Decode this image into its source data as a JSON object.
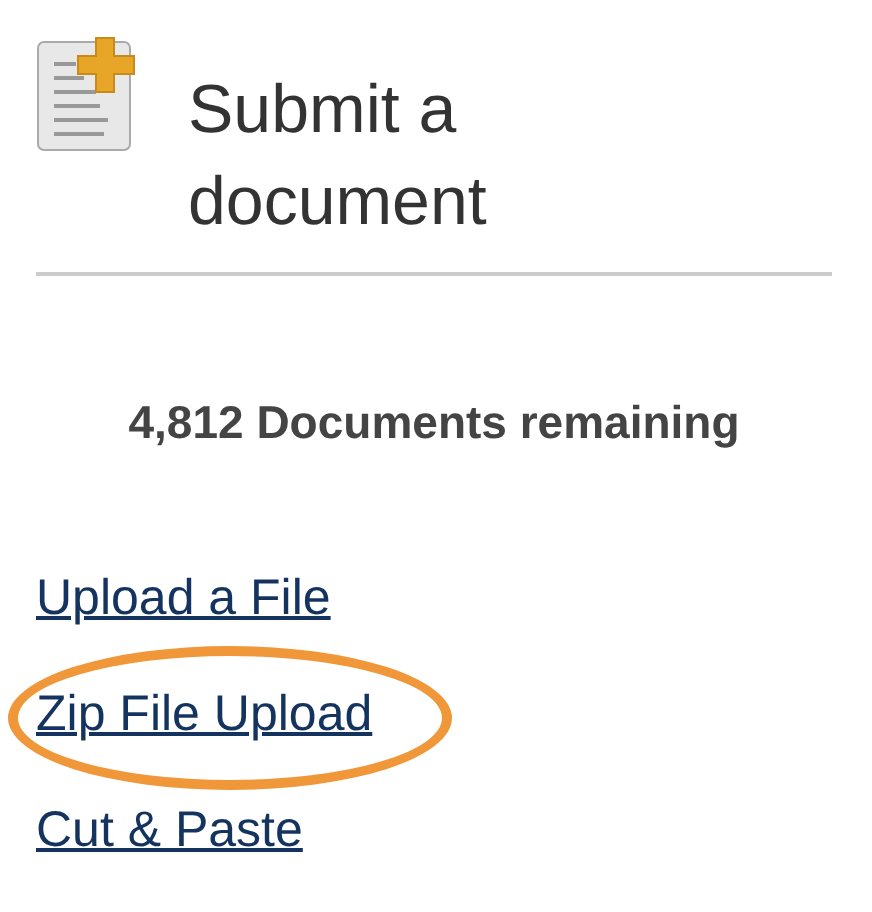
{
  "title": "Submit a document",
  "remaining": "4,812 Documents remaining",
  "links": [
    {
      "label": "Upload a File",
      "highlighted": false
    },
    {
      "label": "Zip File Upload",
      "highlighted": true
    },
    {
      "label": "Cut & Paste",
      "highlighted": false
    }
  ]
}
